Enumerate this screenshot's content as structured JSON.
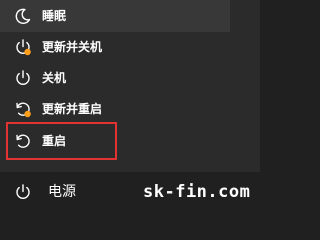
{
  "power_menu": {
    "items": [
      {
        "label": "睡眠",
        "icon": "moon-icon",
        "update_badge": false
      },
      {
        "label": "更新并关机",
        "icon": "power-icon",
        "update_badge": true
      },
      {
        "label": "关机",
        "icon": "power-icon",
        "update_badge": false
      },
      {
        "label": "更新并重启",
        "icon": "restart-icon",
        "update_badge": true
      },
      {
        "label": "重启",
        "icon": "restart-icon",
        "update_badge": false
      }
    ]
  },
  "footer": {
    "power_label": "电源",
    "power_icon": "power-icon"
  },
  "watermark": "sk-fin.com",
  "colors": {
    "menu_background": "#2b2b2b",
    "taskbar_background": "#202020",
    "text": "#ffffff",
    "update_badge": "#ff9f1a",
    "highlight_border": "#e23232"
  }
}
